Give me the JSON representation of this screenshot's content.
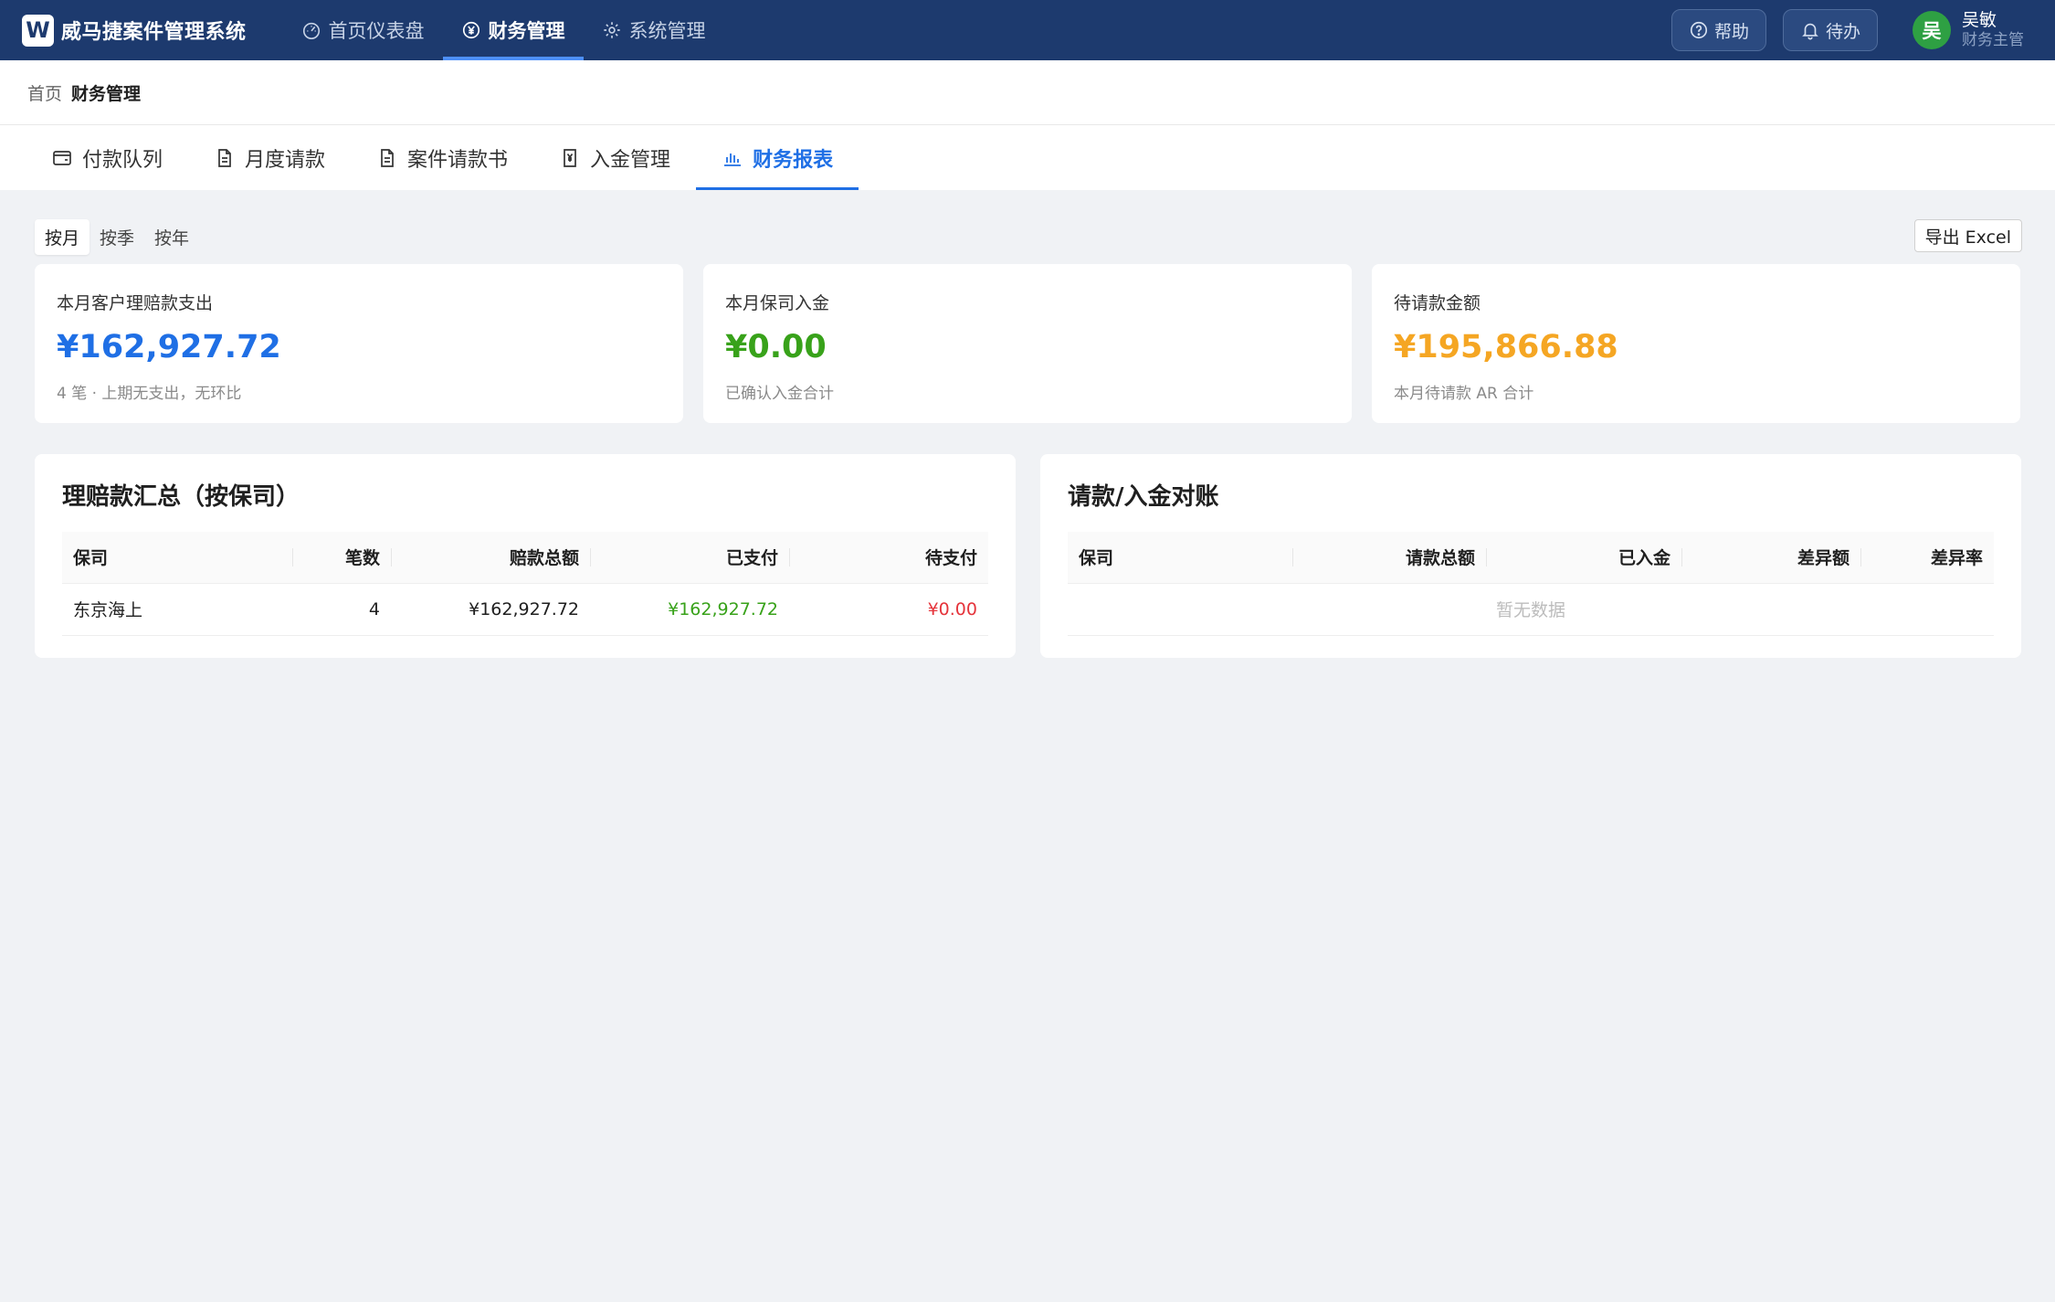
{
  "app": {
    "logo_letter": "W",
    "title": "威马捷案件管理系统"
  },
  "topnav": [
    {
      "label": "首页仪表盘",
      "icon": "dashboard-icon",
      "active": false
    },
    {
      "label": "财务管理",
      "icon": "yen-circle-icon",
      "active": true
    },
    {
      "label": "系统管理",
      "icon": "gear-icon",
      "active": false
    }
  ],
  "header_actions": {
    "help_label": "帮助",
    "todo_label": "待办"
  },
  "user": {
    "avatar_letter": "吴",
    "name": "吴敏",
    "role": "财务主管"
  },
  "breadcrumb": {
    "home": "首页",
    "current": "财务管理"
  },
  "subtabs": [
    {
      "label": "付款队列",
      "icon": "wallet-icon",
      "active": false
    },
    {
      "label": "月度请款",
      "icon": "document-icon",
      "active": false
    },
    {
      "label": "案件请款书",
      "icon": "document-icon",
      "active": false
    },
    {
      "label": "入金管理",
      "icon": "yen-document-icon",
      "active": false
    },
    {
      "label": "财务报表",
      "icon": "bar-chart-icon",
      "active": true
    }
  ],
  "period": {
    "options": [
      "按月",
      "按季",
      "按年"
    ],
    "selected": "按月"
  },
  "export_label": "导出 Excel",
  "stats": [
    {
      "label": "本月客户理赔款支出",
      "value": "¥162,927.72",
      "note": "4 笔 · 上期无支出，无环比",
      "color": "#1f6fe5"
    },
    {
      "label": "本月保司入金",
      "value": "¥0.00",
      "note": "已确认入金合计",
      "color": "#38a21a"
    },
    {
      "label": "待请款金额",
      "value": "¥195,866.88",
      "note": "本月待请款 AR 合计",
      "color": "#f5a623"
    }
  ],
  "claims_summary": {
    "title": "理赔款汇总（按保司）",
    "columns": [
      "保司",
      "笔数",
      "赔款总额",
      "已支付",
      "待支付"
    ],
    "rows": [
      {
        "insurer": "东京海上",
        "count": "4",
        "total": "¥162,927.72",
        "paid": "¥162,927.72",
        "pending": "¥0.00"
      }
    ],
    "paid_color": "#38a21a",
    "pending_color": "#e5343b"
  },
  "reconciliation": {
    "title": "请款/入金对账",
    "columns": [
      "保司",
      "请款总额",
      "已入金",
      "差异额",
      "差异率"
    ],
    "empty_text": "暂无数据"
  }
}
